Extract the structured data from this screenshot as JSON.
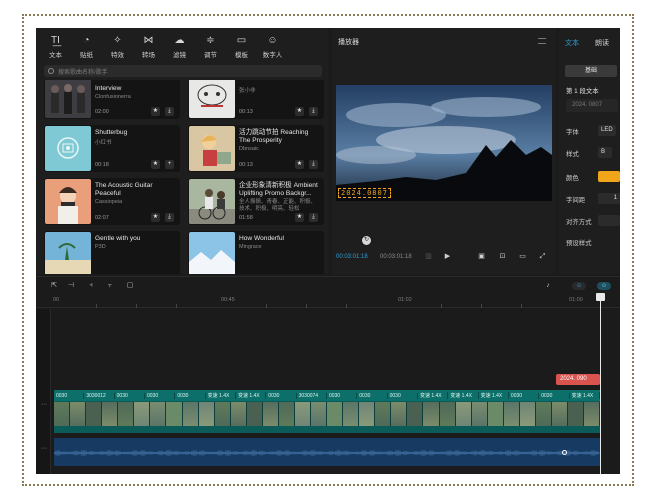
{
  "toolbar": {
    "items": [
      {
        "label": "文本",
        "icon": "text-icon"
      },
      {
        "label": "贴纸",
        "icon": "sticker-icon"
      },
      {
        "label": "特效",
        "icon": "effects-icon"
      },
      {
        "label": "转场",
        "icon": "transition-icon"
      },
      {
        "label": "滤镜",
        "icon": "filter-icon"
      },
      {
        "label": "调节",
        "icon": "adjust-icon"
      },
      {
        "label": "模板",
        "icon": "template-icon"
      },
      {
        "label": "数字人",
        "icon": "avatar-icon"
      }
    ]
  },
  "search": {
    "placeholder": "搜索歌曲名称/歌手"
  },
  "music": [
    {
      "title": "Interview",
      "artist": "Clonfusionerra",
      "duration": "02:00"
    },
    {
      "title": "",
      "artist": "张小非",
      "duration": "00:13"
    },
    {
      "title": "Shutterbug",
      "artist": "小红书",
      "duration": "00:18"
    },
    {
      "title": "活力跳动节拍 Reaching The Prosperity",
      "artist": "Dbnsaic",
      "duration": "00:13"
    },
    {
      "title": "The Acoustic Guitar Peaceful",
      "artist": "Cassiopeia",
      "duration": "02:07"
    },
    {
      "title": "企业形象清新积极 Ambient Uplifting Promo Backgr...",
      "artist": "全人振振、青春、正能、积极、技术、积极、明亮、轻松",
      "duration": "01:58"
    },
    {
      "title": "Gentle with you",
      "artist": "P3D",
      "duration": ""
    },
    {
      "title": "How Wonderful",
      "artist": "Mingrace",
      "duration": ""
    }
  ],
  "player": {
    "title": "播放器",
    "time_current": "00:03:01:18",
    "time_total": "00:03:01:18",
    "overlay_text": "2024.0807"
  },
  "props": {
    "tab_active": "文本",
    "tab_other": "朗读",
    "pill": "基础",
    "section": "第 1 段文本",
    "field_value": "2024. 0807",
    "rows": [
      {
        "label": "字体",
        "value": "LED"
      },
      {
        "label": "样式",
        "value": "B"
      },
      {
        "label": "颜色",
        "value": ""
      },
      {
        "label": "字间距",
        "value": "1"
      },
      {
        "label": "对齐方式",
        "value": ""
      },
      {
        "label": "预设样式",
        "value": ""
      }
    ],
    "accent_color": "#f0a51a"
  },
  "timeline": {
    "ticks": [
      "00",
      "00:45",
      "01:02",
      "01:00"
    ],
    "text_tag": "2024. 090",
    "clip_labels": [
      "0030",
      "3030012",
      "0030",
      "0030",
      "0030",
      "变速 1.4X",
      "变速 1.4X",
      "0030",
      "3030074",
      "0030",
      "0030",
      "0030",
      "变速 1.4X",
      "变速 1.4X",
      "变速 1.4X",
      "0030",
      "0030",
      "变速 1.4X"
    ]
  },
  "colors": {
    "bg": "#1b1b1b",
    "panel": "#1e1e1e",
    "clip": "#0b5c58",
    "audio": "#173a63",
    "accent": "#2b9fd6"
  }
}
